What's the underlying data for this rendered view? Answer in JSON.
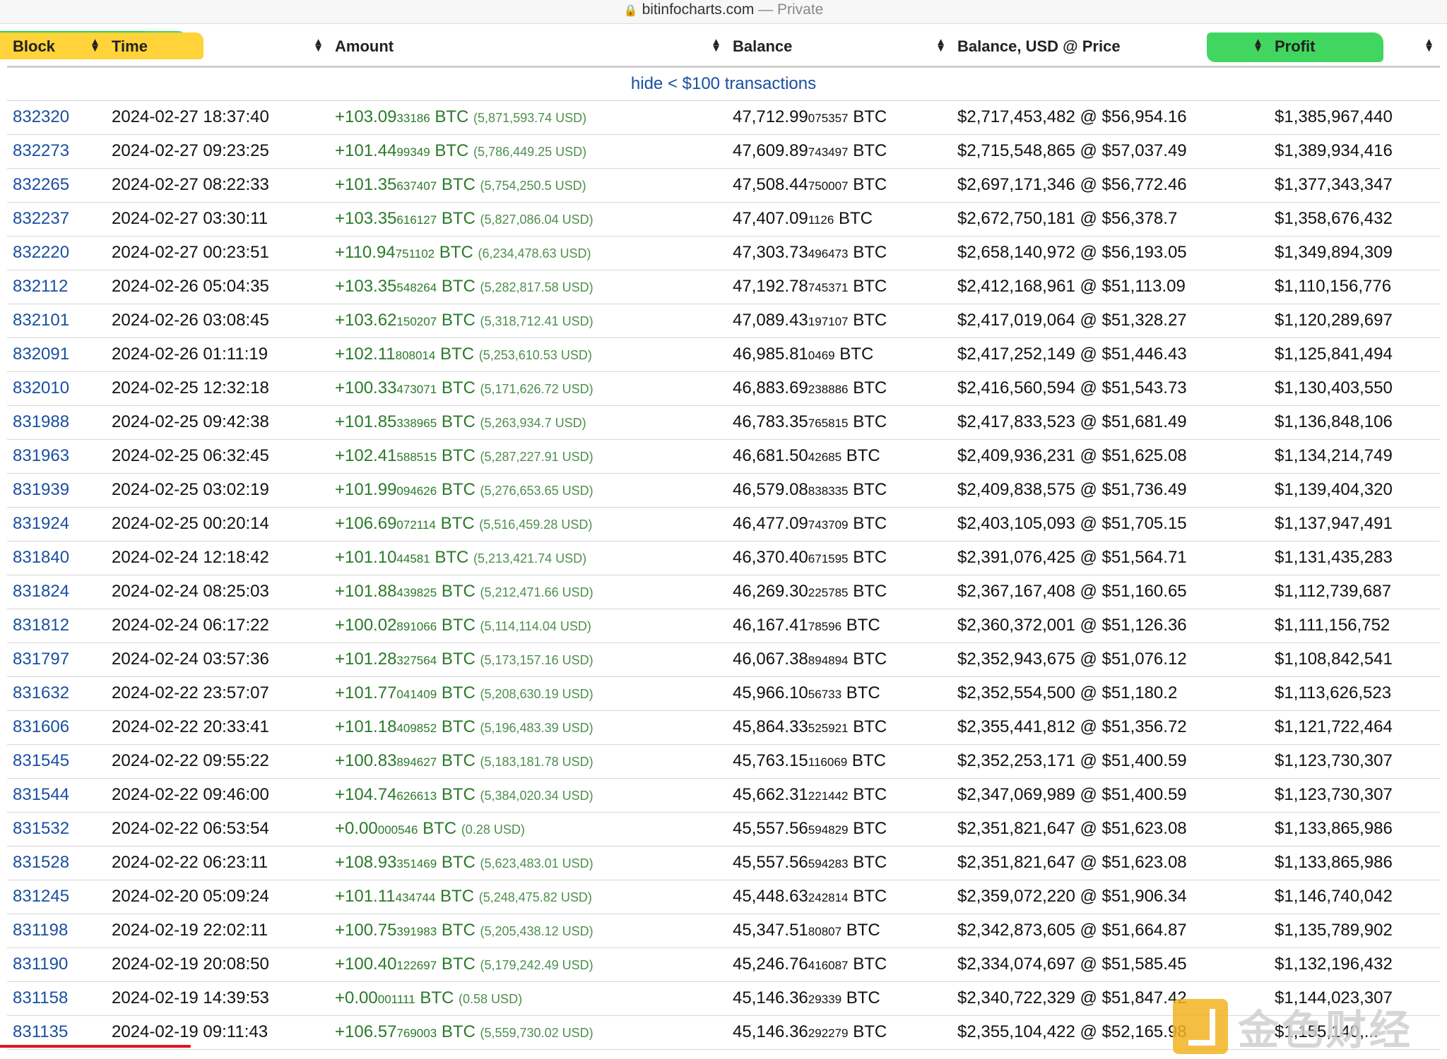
{
  "browser": {
    "domain": "bitinfocharts.com",
    "separator": " — ",
    "mode": "Private"
  },
  "table": {
    "headers": {
      "block": "Block",
      "time": "Time",
      "amount": "Amount",
      "balance": "Balance",
      "balance_usd": "Balance, USD @ Price",
      "profit": "Profit"
    },
    "hide_link": "hide < $100 transactions",
    "rows": [
      {
        "block": "832320",
        "time": "2024-02-27 18:37:40",
        "amt": "+103.09",
        "amt_sat": "33186",
        "amt_usd": "(5,871,593.74 USD)",
        "bal": "47,712.99",
        "bal_sat": "075357",
        "usd": "$2,717,453,482 @ $56,954.16",
        "profit": "$1,385,967,440"
      },
      {
        "block": "832273",
        "time": "2024-02-27 09:23:25",
        "amt": "+101.44",
        "amt_sat": "99349",
        "amt_usd": "(5,786,449.25 USD)",
        "bal": "47,609.89",
        "bal_sat": "743497",
        "usd": "$2,715,548,865 @ $57,037.49",
        "profit": "$1,389,934,416"
      },
      {
        "block": "832265",
        "time": "2024-02-27 08:22:33",
        "amt": "+101.35",
        "amt_sat": "637407",
        "amt_usd": "(5,754,250.5 USD)",
        "bal": "47,508.44",
        "bal_sat": "750007",
        "usd": "$2,697,171,346 @ $56,772.46",
        "profit": "$1,377,343,347"
      },
      {
        "block": "832237",
        "time": "2024-02-27 03:30:11",
        "amt": "+103.35",
        "amt_sat": "616127",
        "amt_usd": "(5,827,086.04 USD)",
        "bal": "47,407.09",
        "bal_sat": "1126",
        "usd": "$2,672,750,181 @ $56,378.7",
        "profit": "$1,358,676,432"
      },
      {
        "block": "832220",
        "time": "2024-02-27 00:23:51",
        "amt": "+110.94",
        "amt_sat": "751102",
        "amt_usd": "(6,234,478.63 USD)",
        "bal": "47,303.73",
        "bal_sat": "496473",
        "usd": "$2,658,140,972 @ $56,193.05",
        "profit": "$1,349,894,309"
      },
      {
        "block": "832112",
        "time": "2024-02-26 05:04:35",
        "amt": "+103.35",
        "amt_sat": "548264",
        "amt_usd": "(5,282,817.58 USD)",
        "bal": "47,192.78",
        "bal_sat": "745371",
        "usd": "$2,412,168,961 @ $51,113.09",
        "profit": "$1,110,156,776"
      },
      {
        "block": "832101",
        "time": "2024-02-26 03:08:45",
        "amt": "+103.62",
        "amt_sat": "150207",
        "amt_usd": "(5,318,712.41 USD)",
        "bal": "47,089.43",
        "bal_sat": "197107",
        "usd": "$2,417,019,064 @ $51,328.27",
        "profit": "$1,120,289,697"
      },
      {
        "block": "832091",
        "time": "2024-02-26 01:11:19",
        "amt": "+102.11",
        "amt_sat": "808014",
        "amt_usd": "(5,253,610.53 USD)",
        "bal": "46,985.81",
        "bal_sat": "0469",
        "usd": "$2,417,252,149 @ $51,446.43",
        "profit": "$1,125,841,494"
      },
      {
        "block": "832010",
        "time": "2024-02-25 12:32:18",
        "amt": "+100.33",
        "amt_sat": "473071",
        "amt_usd": "(5,171,626.72 USD)",
        "bal": "46,883.69",
        "bal_sat": "238886",
        "usd": "$2,416,560,594 @ $51,543.73",
        "profit": "$1,130,403,550"
      },
      {
        "block": "831988",
        "time": "2024-02-25 09:42:38",
        "amt": "+101.85",
        "amt_sat": "338965",
        "amt_usd": "(5,263,934.7 USD)",
        "bal": "46,783.35",
        "bal_sat": "765815",
        "usd": "$2,417,833,523 @ $51,681.49",
        "profit": "$1,136,848,106"
      },
      {
        "block": "831963",
        "time": "2024-02-25 06:32:45",
        "amt": "+102.41",
        "amt_sat": "588515",
        "amt_usd": "(5,287,227.91 USD)",
        "bal": "46,681.50",
        "bal_sat": "42685",
        "usd": "$2,409,936,231 @ $51,625.08",
        "profit": "$1,134,214,749"
      },
      {
        "block": "831939",
        "time": "2024-02-25 03:02:19",
        "amt": "+101.99",
        "amt_sat": "094626",
        "amt_usd": "(5,276,653.65 USD)",
        "bal": "46,579.08",
        "bal_sat": "838335",
        "usd": "$2,409,838,575 @ $51,736.49",
        "profit": "$1,139,404,320"
      },
      {
        "block": "831924",
        "time": "2024-02-25 00:20:14",
        "amt": "+106.69",
        "amt_sat": "072114",
        "amt_usd": "(5,516,459.28 USD)",
        "bal": "46,477.09",
        "bal_sat": "743709",
        "usd": "$2,403,105,093 @ $51,705.15",
        "profit": "$1,137,947,491"
      },
      {
        "block": "831840",
        "time": "2024-02-24 12:18:42",
        "amt": "+101.10",
        "amt_sat": "44581",
        "amt_usd": "(5,213,421.74 USD)",
        "bal": "46,370.40",
        "bal_sat": "671595",
        "usd": "$2,391,076,425 @ $51,564.71",
        "profit": "$1,131,435,283"
      },
      {
        "block": "831824",
        "time": "2024-02-24 08:25:03",
        "amt": "+101.88",
        "amt_sat": "439825",
        "amt_usd": "(5,212,471.66 USD)",
        "bal": "46,269.30",
        "bal_sat": "225785",
        "usd": "$2,367,167,408 @ $51,160.65",
        "profit": "$1,112,739,687"
      },
      {
        "block": "831812",
        "time": "2024-02-24 06:17:22",
        "amt": "+100.02",
        "amt_sat": "891066",
        "amt_usd": "(5,114,114.04 USD)",
        "bal": "46,167.41",
        "bal_sat": "78596",
        "usd": "$2,360,372,001 @ $51,126.36",
        "profit": "$1,111,156,752"
      },
      {
        "block": "831797",
        "time": "2024-02-24 03:57:36",
        "amt": "+101.28",
        "amt_sat": "327564",
        "amt_usd": "(5,173,157.16 USD)",
        "bal": "46,067.38",
        "bal_sat": "894894",
        "usd": "$2,352,943,675 @ $51,076.12",
        "profit": "$1,108,842,541"
      },
      {
        "block": "831632",
        "time": "2024-02-22 23:57:07",
        "amt": "+101.77",
        "amt_sat": "041409",
        "amt_usd": "(5,208,630.19 USD)",
        "bal": "45,966.10",
        "bal_sat": "56733",
        "usd": "$2,352,554,500 @ $51,180.2",
        "profit": "$1,113,626,523"
      },
      {
        "block": "831606",
        "time": "2024-02-22 20:33:41",
        "amt": "+101.18",
        "amt_sat": "409852",
        "amt_usd": "(5,196,483.39 USD)",
        "bal": "45,864.33",
        "bal_sat": "525921",
        "usd": "$2,355,441,812 @ $51,356.72",
        "profit": "$1,121,722,464"
      },
      {
        "block": "831545",
        "time": "2024-02-22 09:55:22",
        "amt": "+100.83",
        "amt_sat": "894627",
        "amt_usd": "(5,183,181.78 USD)",
        "bal": "45,763.15",
        "bal_sat": "116069",
        "usd": "$2,352,253,171 @ $51,400.59",
        "profit": "$1,123,730,307"
      },
      {
        "block": "831544",
        "time": "2024-02-22 09:46:00",
        "amt": "+104.74",
        "amt_sat": "626613",
        "amt_usd": "(5,384,020.34 USD)",
        "bal": "45,662.31",
        "bal_sat": "221442",
        "usd": "$2,347,069,989 @ $51,400.59",
        "profit": "$1,123,730,307"
      },
      {
        "block": "831532",
        "time": "2024-02-22 06:53:54",
        "amt": "+0.00",
        "amt_sat": "000546",
        "amt_usd": "(0.28 USD)",
        "bal": "45,557.56",
        "bal_sat": "594829",
        "usd": "$2,351,821,647 @ $51,623.08",
        "profit": "$1,133,865,986"
      },
      {
        "block": "831528",
        "time": "2024-02-22 06:23:11",
        "amt": "+108.93",
        "amt_sat": "351469",
        "amt_usd": "(5,623,483.01 USD)",
        "bal": "45,557.56",
        "bal_sat": "594283",
        "usd": "$2,351,821,647 @ $51,623.08",
        "profit": "$1,133,865,986"
      },
      {
        "block": "831245",
        "time": "2024-02-20 05:09:24",
        "amt": "+101.11",
        "amt_sat": "434744",
        "amt_usd": "(5,248,475.82 USD)",
        "bal": "45,448.63",
        "bal_sat": "242814",
        "usd": "$2,359,072,220 @ $51,906.34",
        "profit": "$1,146,740,042"
      },
      {
        "block": "831198",
        "time": "2024-02-19 22:02:11",
        "amt": "+100.75",
        "amt_sat": "391983",
        "amt_usd": "(5,205,438.12 USD)",
        "bal": "45,347.51",
        "bal_sat": "80807",
        "usd": "$2,342,873,605 @ $51,664.87",
        "profit": "$1,135,789,902"
      },
      {
        "block": "831190",
        "time": "2024-02-19 20:08:50",
        "amt": "+100.40",
        "amt_sat": "122697",
        "amt_usd": "(5,179,242.49 USD)",
        "bal": "45,246.76",
        "bal_sat": "416087",
        "usd": "$2,334,074,697 @ $51,585.45",
        "profit": "$1,132,196,432"
      },
      {
        "block": "831158",
        "time": "2024-02-19 14:39:53",
        "amt": "+0.00",
        "amt_sat": "001111",
        "amt_usd": "(0.58 USD)",
        "bal": "45,146.36",
        "bal_sat": "29339",
        "usd": "$2,340,722,329 @ $51,847.42",
        "profit": "$1,144,023,307"
      },
      {
        "block": "831135",
        "time": "2024-02-19 09:11:43",
        "amt": "+106.57",
        "amt_sat": "769003",
        "amt_usd": "(5,559,730.02 USD)",
        "bal": "45,146.36",
        "bal_sat": "292279",
        "usd": "$2,355,104,422 @ $52,165.98",
        "profit": "$1,155,140,..."
      }
    ],
    "unit": "BTC"
  },
  "watermark": {
    "text": "金色财经"
  },
  "colors": {
    "link": "#1a4fa0",
    "amount": "#2a7a2a",
    "highlight_yellow": "#ffd23a",
    "highlight_green": "#2bd24e",
    "underline_red": "#e0141e"
  }
}
